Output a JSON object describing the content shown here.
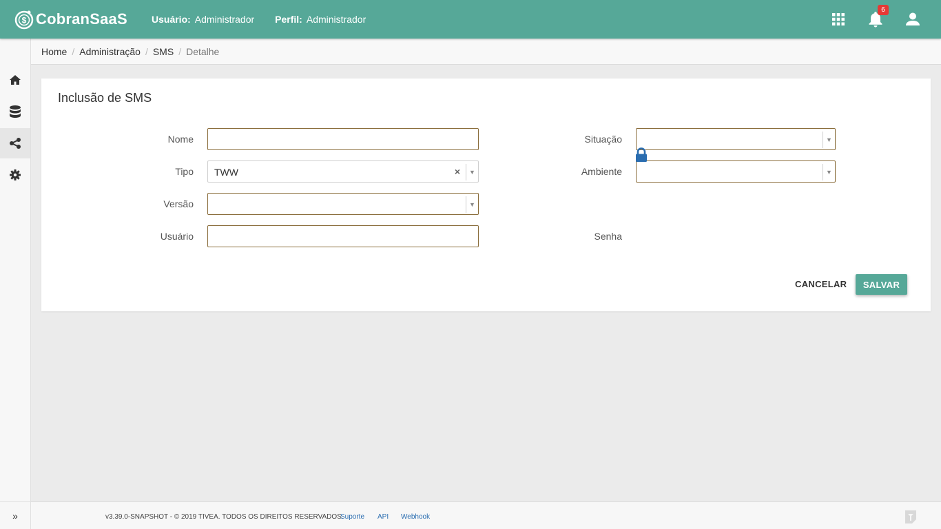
{
  "header": {
    "app_name": "CobranSaaS",
    "user_label": "Usuário:",
    "user_value": "Administrador",
    "profile_label": "Perfil:",
    "profile_value": "Administrador",
    "notification_count": "6",
    "accent_color": "#56a898"
  },
  "sidebar": {
    "items": [
      {
        "icon": "home-icon"
      },
      {
        "icon": "database-icon"
      },
      {
        "icon": "share-icon",
        "active": true
      },
      {
        "icon": "gear-icon"
      }
    ],
    "expand_label": "»"
  },
  "breadcrumb": [
    "Home",
    "Administração",
    "SMS",
    "Detalhe"
  ],
  "form": {
    "title": "Inclusão de SMS",
    "nome_label": "Nome",
    "nome_value": "",
    "tipo_label": "Tipo",
    "tipo_value": "TWW",
    "versao_label": "Versão",
    "versao_value": "",
    "usuario_label": "Usuário",
    "usuario_value": "",
    "situacao_label": "Situação",
    "situacao_value": "",
    "ambiente_label": "Ambiente",
    "ambiente_value": "",
    "senha_label": "Senha",
    "clear_symbol": "×",
    "arrow_symbol": "▼",
    "cancel_label": "CANCELAR",
    "save_label": "SALVAR"
  },
  "footer": {
    "copyright": "v3.39.0-SNAPSHOT - © 2019 TIVEA. TODOS OS DIREITOS RESERVADOS.",
    "links": [
      "Suporte",
      "API",
      "Webhook"
    ]
  }
}
